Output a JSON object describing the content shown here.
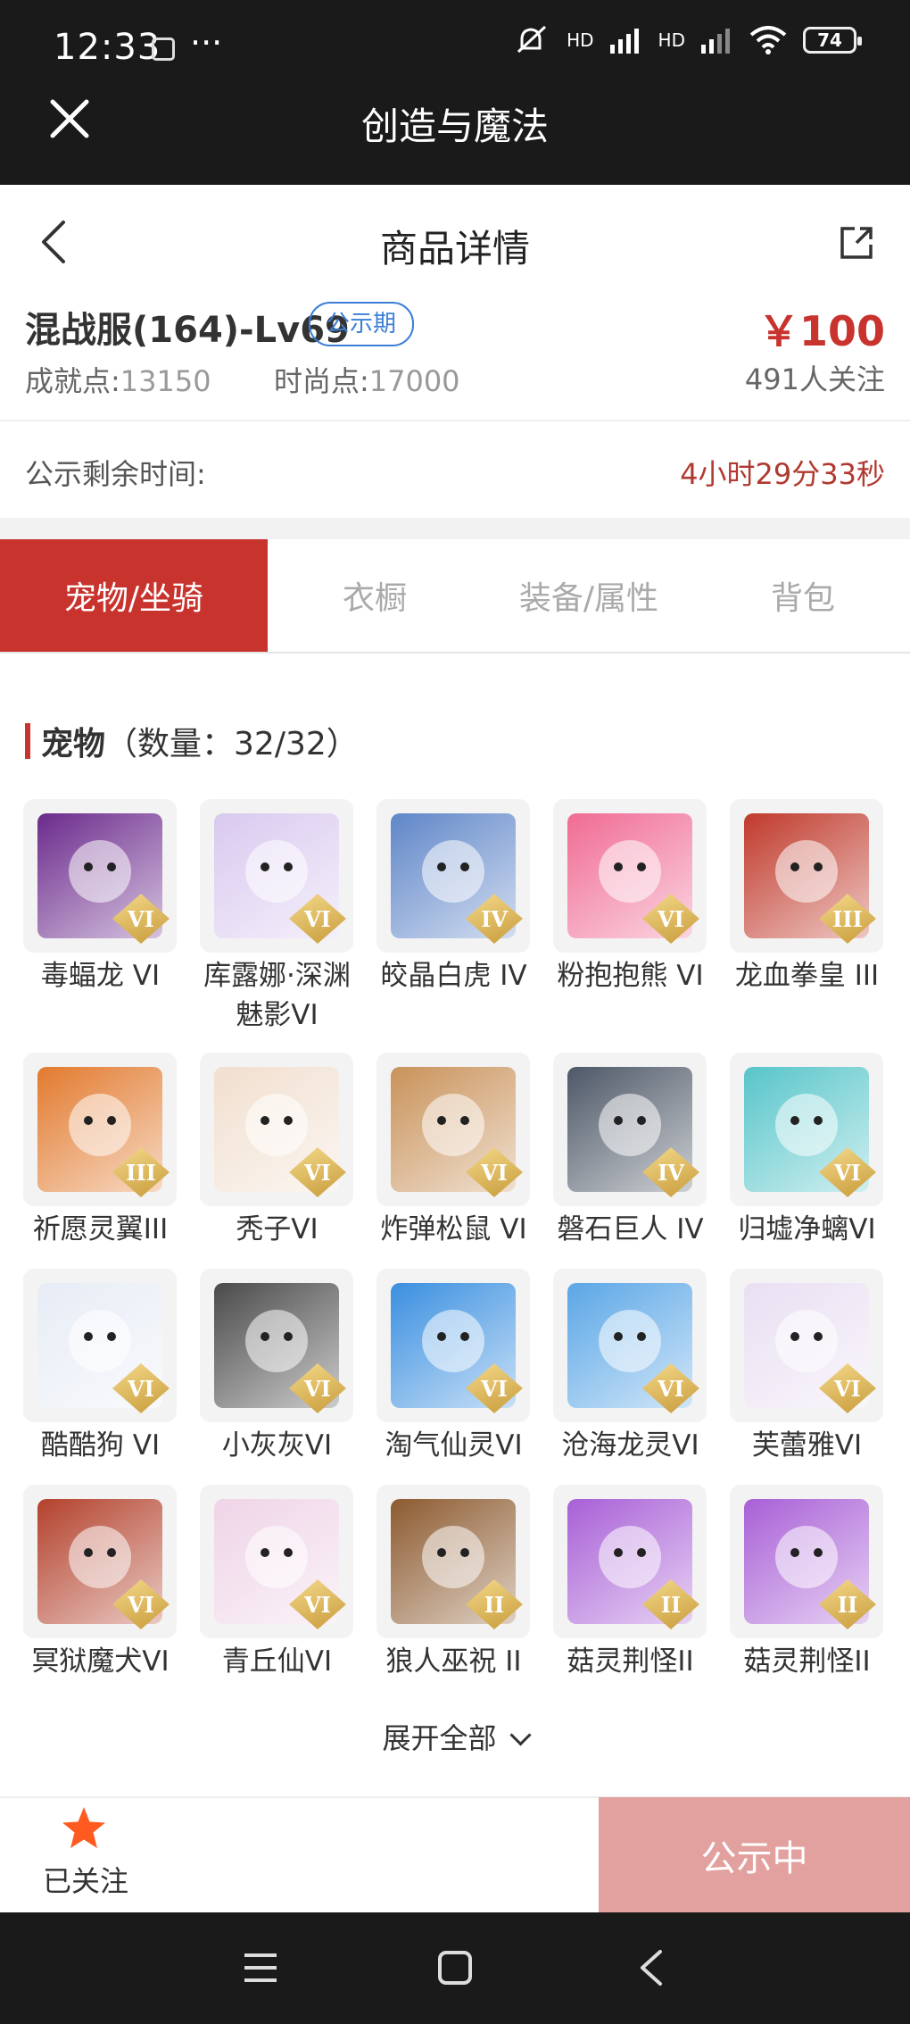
{
  "status_bar": {
    "time": "12:33",
    "more": "···",
    "network_label": "HD",
    "battery": "74"
  },
  "app_bar": {
    "title": "创造与魔法"
  },
  "page": {
    "title": "商品详情"
  },
  "item": {
    "name": "混战服(164)-Lv69",
    "badge": "公示期",
    "price": "￥100",
    "achievement_label": "成就点:",
    "achievement_value": "13150",
    "fashion_label": "时尚点:",
    "fashion_value": "17000",
    "follows": "491人关注"
  },
  "timer": {
    "label": "公示剩余时间:",
    "value": "4小时29分33秒"
  },
  "tabs": [
    {
      "label": "宠物/坐骑",
      "active": true
    },
    {
      "label": "衣橱",
      "active": false
    },
    {
      "label": "装备/属性",
      "active": false
    },
    {
      "label": "背包",
      "active": false
    }
  ],
  "section": {
    "title": "宠物",
    "count_text": "（数量：32/32）"
  },
  "pets": [
    {
      "name": "毒蝠龙 VI",
      "tier": "VI",
      "color": "#6b2a8c"
    },
    {
      "name": "库露娜·深渊魅影VI",
      "tier": "VI",
      "color": "#d9c9ef"
    },
    {
      "name": "皎晶白虎 IV",
      "tier": "IV",
      "color": "#5f86c8"
    },
    {
      "name": "粉抱抱熊 VI",
      "tier": "VI",
      "color": "#f06b94"
    },
    {
      "name": "龙血拳皇 III",
      "tier": "III",
      "color": "#c0392b"
    },
    {
      "name": "祈愿灵翼III",
      "tier": "III",
      "color": "#e27a2e"
    },
    {
      "name": "秃子VI",
      "tier": "VI",
      "color": "#f1dfcf"
    },
    {
      "name": "炸弹松鼠 VI",
      "tier": "VI",
      "color": "#c9925a"
    },
    {
      "name": "磐石巨人 IV",
      "tier": "IV",
      "color": "#4d5766"
    },
    {
      "name": "归墟净螭VI",
      "tier": "VI",
      "color": "#57c5c9"
    },
    {
      "name": "酷酷狗 VI",
      "tier": "VI",
      "color": "#e7ecf5"
    },
    {
      "name": "小灰灰VI",
      "tier": "VI",
      "color": "#4a4a4a"
    },
    {
      "name": "淘气仙灵VI",
      "tier": "VI",
      "color": "#3a8fe0"
    },
    {
      "name": "沧海龙灵VI",
      "tier": "VI",
      "color": "#5aa6e6"
    },
    {
      "name": "芙蕾雅VI",
      "tier": "VI",
      "color": "#e9dff2"
    },
    {
      "name": "冥狱魔犬VI",
      "tier": "VI",
      "color": "#b3412c"
    },
    {
      "name": "青丘仙VI",
      "tier": "VI",
      "color": "#efd4e7"
    },
    {
      "name": "狼人巫祝 II",
      "tier": "II",
      "color": "#8c5a2f"
    },
    {
      "name": "菇灵荆怪II",
      "tier": "II",
      "color": "#a85fd6"
    },
    {
      "name": "菇灵荆怪II",
      "tier": "II",
      "color": "#a85fd6"
    }
  ],
  "expand": {
    "label": "展开全部"
  },
  "bottom": {
    "followed_label": "已关注",
    "status_button": "公示中"
  },
  "colors": {
    "accent": "#c8332e",
    "badge": "#3b7fd6",
    "star": "#ff5a1f"
  }
}
